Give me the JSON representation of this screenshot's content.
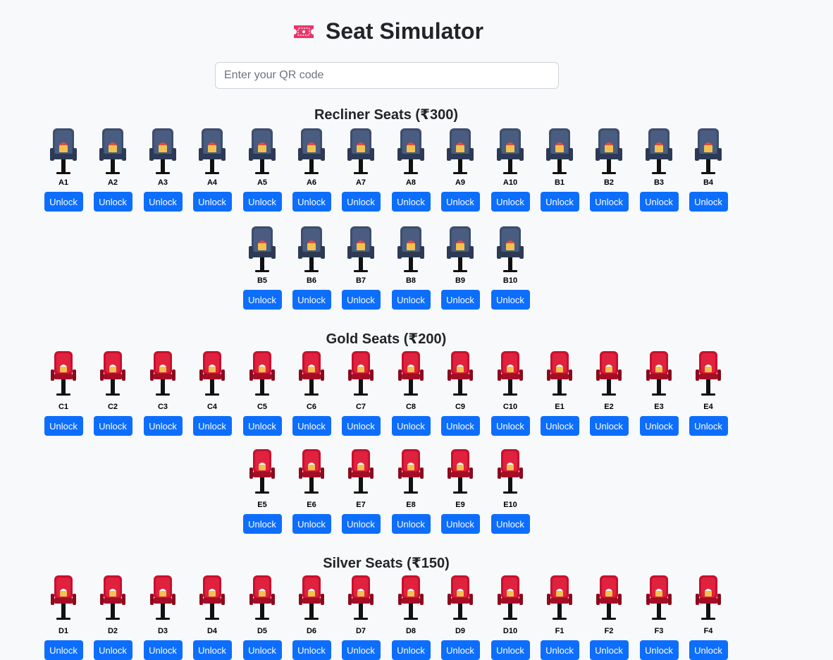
{
  "header": {
    "title": "Seat Simulator",
    "icon": "ticket-icon"
  },
  "qr_input": {
    "placeholder": "Enter your QR code",
    "value": ""
  },
  "sections": [
    {
      "title": "Recliner Seats (₹300)",
      "seat_style": "recliner",
      "rows": [
        [
          "A1",
          "A2",
          "A3",
          "A4",
          "A5",
          "A6",
          "A7",
          "A8",
          "A9",
          "A10",
          "B1",
          "B2",
          "B3",
          "B4"
        ],
        [
          "B5",
          "B6",
          "B7",
          "B8",
          "B9",
          "B10"
        ]
      ]
    },
    {
      "title": "Gold Seats (₹200)",
      "seat_style": "red",
      "rows": [
        [
          "C1",
          "C2",
          "C3",
          "C4",
          "C5",
          "C6",
          "C7",
          "C8",
          "C9",
          "C10",
          "E1",
          "E2",
          "E3",
          "E4"
        ],
        [
          "E5",
          "E6",
          "E7",
          "E8",
          "E9",
          "E10"
        ]
      ]
    },
    {
      "title": "Silver Seats (₹150)",
      "seat_style": "red",
      "rows": [
        [
          "D1",
          "D2",
          "D3",
          "D4",
          "D5",
          "D6",
          "D7",
          "D8",
          "D9",
          "D10",
          "F1",
          "F2",
          "F3",
          "F4"
        ]
      ]
    }
  ],
  "seat_button_label": "Unlock",
  "colors": {
    "button": "#0d6efd",
    "recliner_seat": "#3d4e6e",
    "red_seat": "#c8102e",
    "background": "#f8f9fa"
  }
}
